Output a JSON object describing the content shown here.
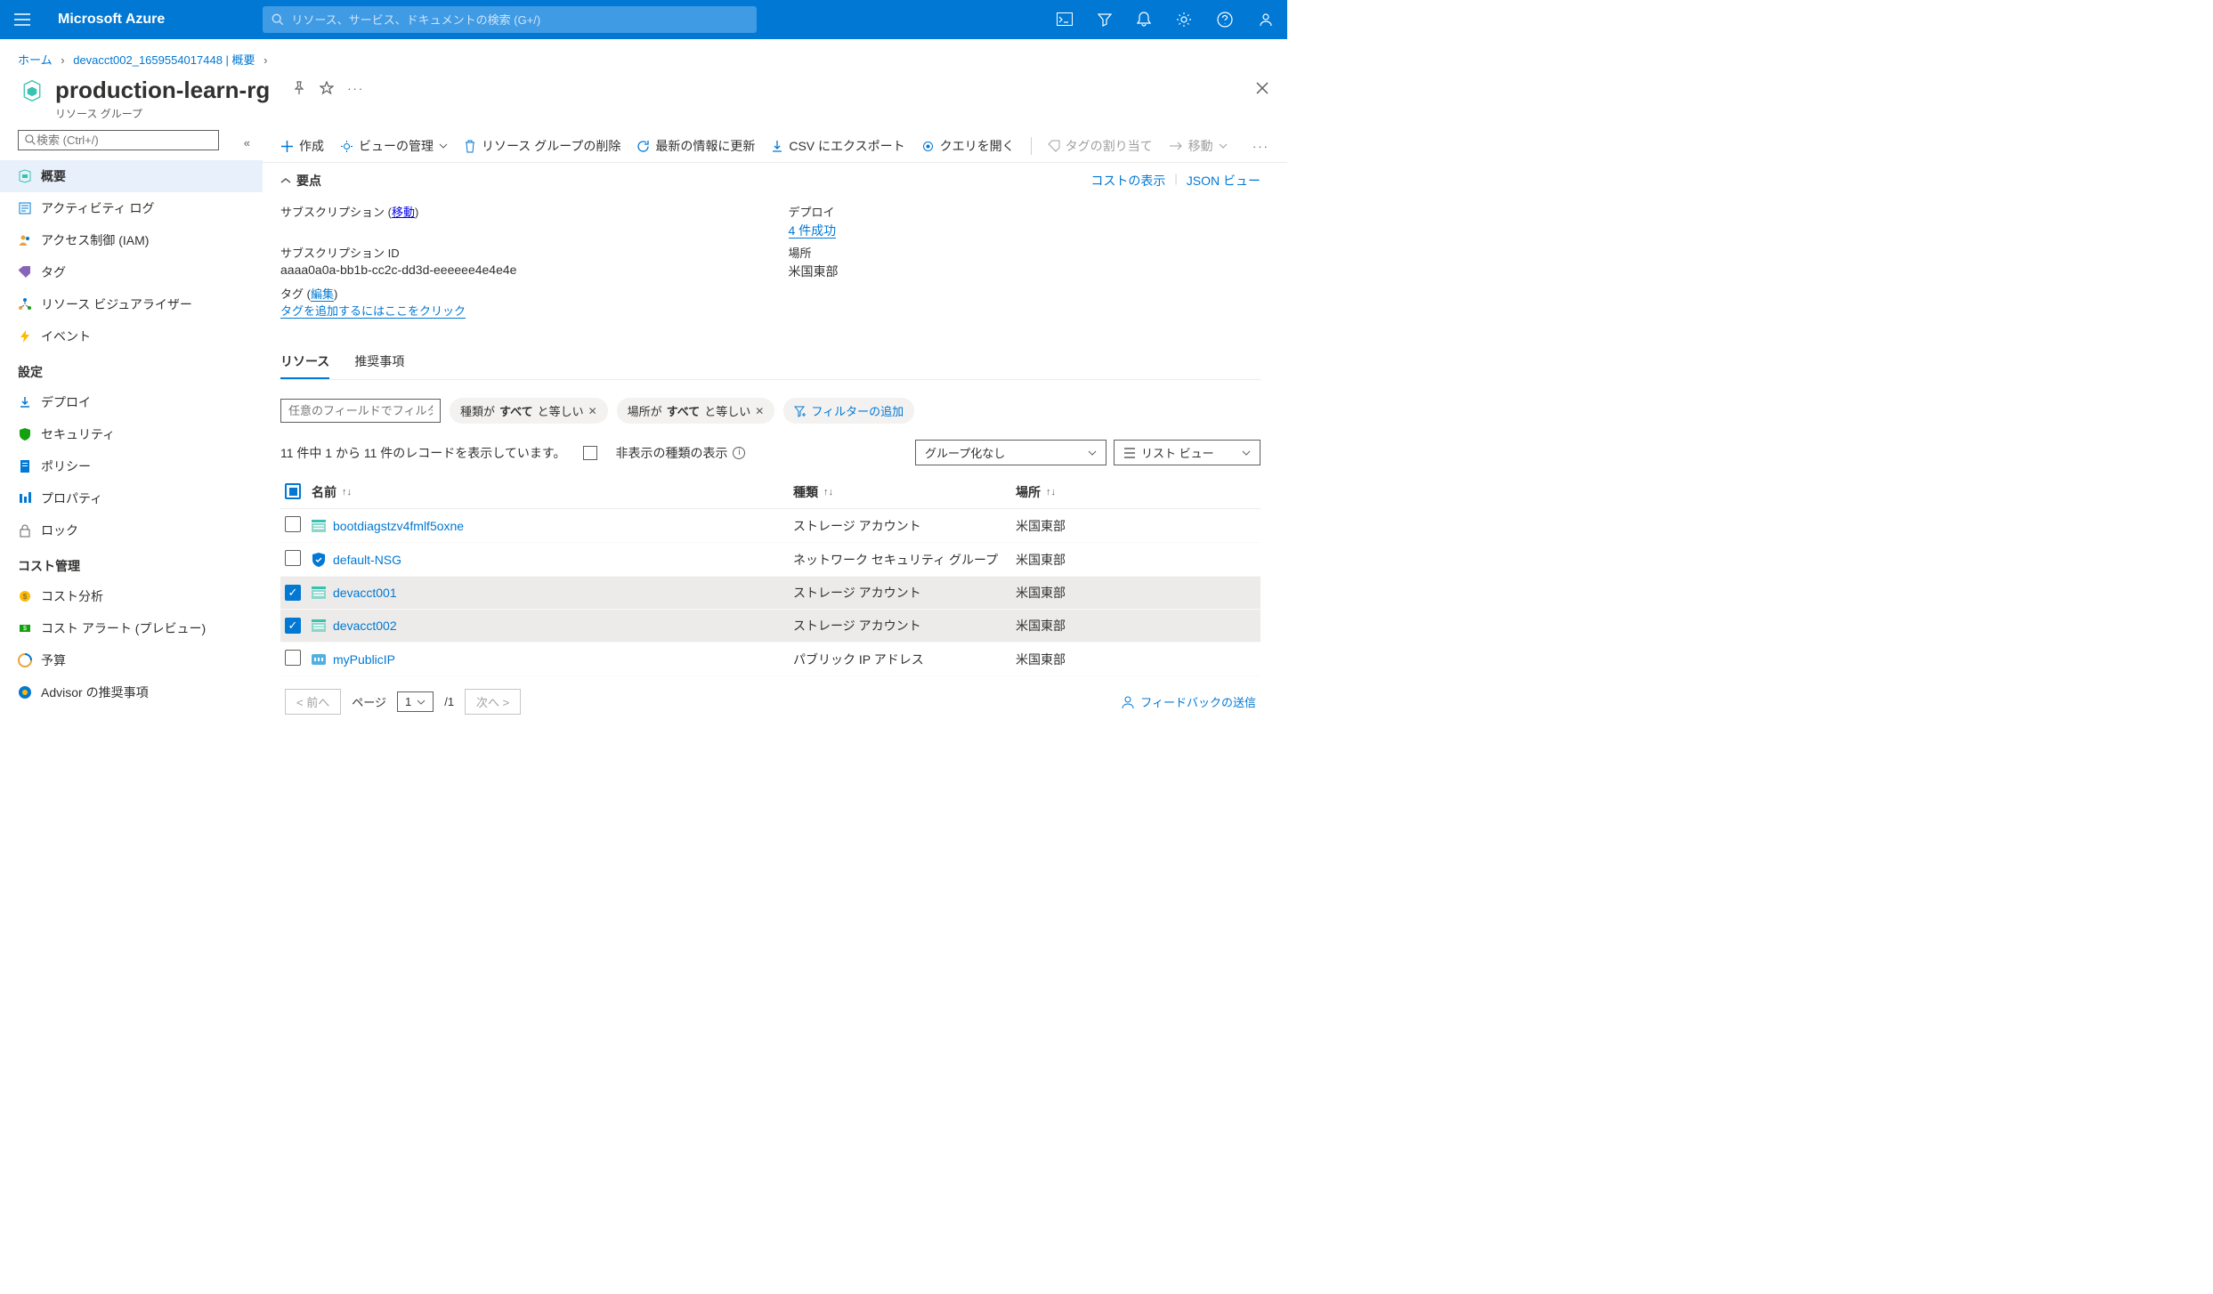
{
  "topbar": {
    "brand": "Microsoft Azure",
    "search_placeholder": "リソース、サービス、ドキュメントの検索 (G+/)"
  },
  "breadcrumb": {
    "home": "ホーム",
    "parent": "devacct002_1659554017448 | 概要"
  },
  "page": {
    "title": "production-learn-rg",
    "subtitle": "リソース グループ"
  },
  "sidebar": {
    "search_placeholder": "検索 (Ctrl+/)",
    "items": [
      {
        "label": "概要",
        "active": true
      },
      {
        "label": "アクティビティ ログ"
      },
      {
        "label": "アクセス制御 (IAM)"
      },
      {
        "label": "タグ"
      },
      {
        "label": "リソース ビジュアライザー"
      },
      {
        "label": "イベント"
      }
    ],
    "section_settings": "設定",
    "settings_items": [
      {
        "label": "デプロイ"
      },
      {
        "label": "セキュリティ"
      },
      {
        "label": "ポリシー"
      },
      {
        "label": "プロパティ"
      },
      {
        "label": "ロック"
      }
    ],
    "section_cost": "コスト管理",
    "cost_items": [
      {
        "label": "コスト分析"
      },
      {
        "label": "コスト アラート (プレビュー)"
      },
      {
        "label": "予算"
      },
      {
        "label": "Advisor の推奨事項"
      }
    ]
  },
  "toolbar": {
    "create": "作成",
    "view_mgmt": "ビューの管理",
    "delete_rg": "リソース グループの削除",
    "refresh": "最新の情報に更新",
    "export_csv": "CSV にエクスポート",
    "open_query": "クエリを開く",
    "assign_tag": "タグの割り当て",
    "move": "移動"
  },
  "essentials": {
    "toggle": "要点",
    "cost_link": "コストの表示",
    "json_link": "JSON ビュー",
    "subscription_label": "サブスクリプション",
    "subscription_move": "移動",
    "sub_id_label": "サブスクリプション ID",
    "sub_id_value": "aaaa0a0a-bb1b-cc2c-dd3d-eeeeee4e4e4e",
    "deploy_label": "デプロイ",
    "deploy_value": "4 件成功",
    "location_label": "場所",
    "location_value": "米国東部",
    "tags_label": "タグ",
    "tags_edit": "編集",
    "tags_add": "タグを追加するにはここをクリック"
  },
  "tabs": {
    "resources": "リソース",
    "recommendations": "推奨事項"
  },
  "filter": {
    "placeholder": "任意のフィールドでフィルター...",
    "type_pill_1": "種類が ",
    "type_pill_b": "すべて",
    "type_pill_2": " と等しい",
    "loc_pill_1": "場所が ",
    "loc_pill_b": "すべて",
    "loc_pill_2": " と等しい",
    "add_filter": "フィルターの追加"
  },
  "results": {
    "count_text": "11 件中 1 から 11 件のレコードを表示しています。",
    "hidden_types": "非表示の種類の表示",
    "group_by": "グループ化なし",
    "list_view": "リスト ビュー"
  },
  "table": {
    "col_name": "名前",
    "col_type": "種類",
    "col_location": "場所",
    "rows": [
      {
        "name": "bootdiagstzv4fmlf5oxne",
        "type": "ストレージ アカウント",
        "location": "米国東部",
        "selected": false,
        "icon": "storage"
      },
      {
        "name": "default-NSG",
        "type": "ネットワーク セキュリティ グループ",
        "location": "米国東部",
        "selected": false,
        "icon": "nsg"
      },
      {
        "name": "devacct001",
        "type": "ストレージ アカウント",
        "location": "米国東部",
        "selected": true,
        "icon": "storage"
      },
      {
        "name": "devacct002",
        "type": "ストレージ アカウント",
        "location": "米国東部",
        "selected": true,
        "icon": "storage"
      },
      {
        "name": "myPublicIP",
        "type": "パブリック IP アドレス",
        "location": "米国東部",
        "selected": false,
        "icon": "ip"
      }
    ]
  },
  "pagination": {
    "prev": "< 前へ",
    "next": "次へ >",
    "page_label": "ページ",
    "page_num": "1",
    "page_total": "/1",
    "feedback": "フィードバックの送信"
  }
}
